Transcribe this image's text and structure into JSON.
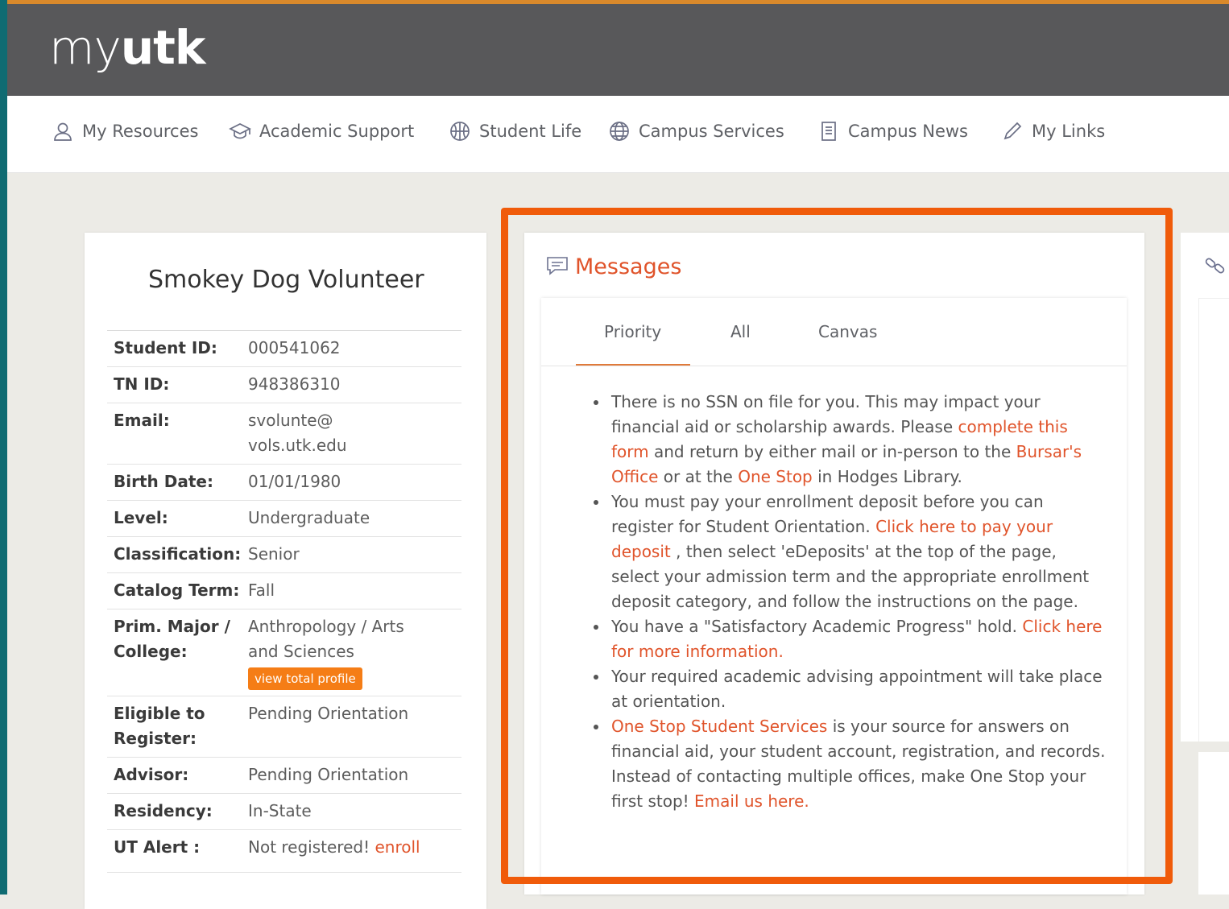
{
  "header": {
    "logo_light": "my",
    "logo_bold": "utk"
  },
  "nav": {
    "items": [
      {
        "label": "My Resources",
        "icon": "user-icon"
      },
      {
        "label": "Academic Support",
        "icon": "graduation-cap-icon"
      },
      {
        "label": "Student Life",
        "icon": "basketball-icon"
      },
      {
        "label": "Campus Services",
        "icon": "globe-icon"
      },
      {
        "label": "Campus News",
        "icon": "document-icon"
      },
      {
        "label": "My Links",
        "icon": "pencil-icon"
      }
    ]
  },
  "profile": {
    "name": "Smokey Dog Volunteer",
    "rows": [
      {
        "label": "Student ID:",
        "value": "000541062"
      },
      {
        "label": "TN ID:",
        "value": "948386310"
      },
      {
        "label": "Email:",
        "value": "svolunte@ vols.utk.edu"
      },
      {
        "label": "Birth Date:",
        "value": "01/01/1980"
      },
      {
        "label": "Level:",
        "value": "Undergraduate"
      },
      {
        "label": "Classification:",
        "value": "Senior"
      },
      {
        "label": "Catalog Term:",
        "value": "Fall"
      },
      {
        "label": "Prim. Major / College:",
        "value": "Anthropology / Arts and Sciences"
      },
      {
        "label": "Eligible to Register:",
        "value": "Pending Orientation"
      },
      {
        "label": "Advisor:",
        "value": "Pending Orientation"
      },
      {
        "label": "Residency:",
        "value": "In-State"
      },
      {
        "label": "UT Alert :",
        "value": "Not registered!"
      }
    ],
    "view_profile_button": "view total profile",
    "enroll_link": "enroll"
  },
  "messages": {
    "title": "Messages",
    "tabs": [
      "Priority",
      "All",
      "Canvas"
    ],
    "active_tab": "Priority",
    "items": [
      {
        "t1": "There is no SSN on file for you. This may impact your financial aid or scholarship awards. Please ",
        "l1": "complete this form",
        "t2": " and return by either mail or in-person to the ",
        "l2": "Bursar's Office",
        "t3": " or at the ",
        "l3": "One Stop",
        "t4": " in Hodges Library."
      },
      {
        "t1": "You must pay your enrollment deposit before you can register for Student Orientation. ",
        "l1": "Click here to pay your deposit",
        "t2": " , then select 'eDeposits' at the top of the page, select your admission term and the appropriate enrollment deposit category, and follow the instructions on the page."
      },
      {
        "t1": "You have a \"Satisfactory Academic Progress\" hold. ",
        "l1": "Click here for more information."
      },
      {
        "t1": "Your required academic advising appointment will take place at orientation."
      },
      {
        "l1": "One Stop Student Services",
        "t1": " is your source for answers on financial aid, your student account, registration, and records. Instead of contacting multiple offices, make One Stop your first stop!  ",
        "l2": "Email us here."
      }
    ]
  },
  "colors": {
    "accent": "#e0542b",
    "highlight": "#f05b0a",
    "header": "#58585a",
    "button": "#f57d16"
  }
}
